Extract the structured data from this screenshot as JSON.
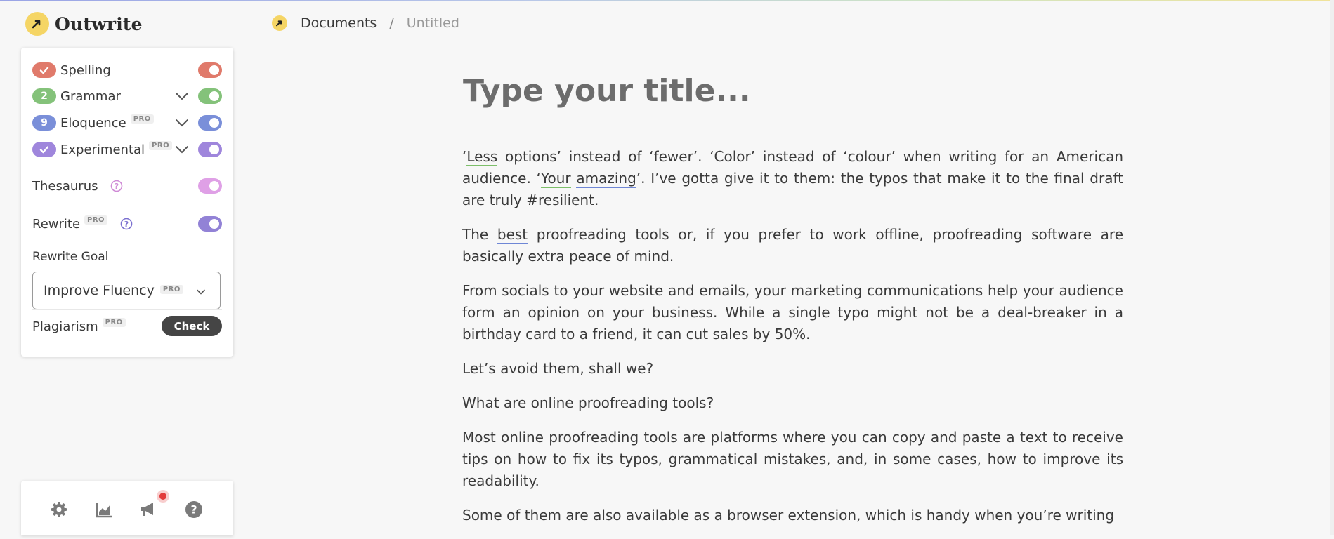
{
  "app": {
    "name": "Outwrite"
  },
  "breadcrumb": {
    "root": "Documents",
    "separator": "/",
    "current": "Untitled"
  },
  "colors": {
    "spelling": "#e07a6b",
    "grammar": "#84c27a",
    "eloquence": "#7a8fd9",
    "experimental": "#9f86dc",
    "thesaurus": "#dfa0e6",
    "rewrite": "#9282d6"
  },
  "settings": {
    "spelling": {
      "label": "Spelling",
      "badge_icon": "check-icon",
      "enabled": true
    },
    "grammar": {
      "label": "Grammar",
      "count": "2",
      "enabled": true
    },
    "eloquence": {
      "label": "Eloquence",
      "count": "9",
      "pro": "PRO",
      "enabled": true
    },
    "experimental": {
      "label": "Experimental",
      "badge_icon": "check-icon",
      "pro": "PRO",
      "enabled": true
    },
    "thesaurus": {
      "label": "Thesaurus",
      "enabled": true
    },
    "rewrite": {
      "label": "Rewrite",
      "pro": "PRO",
      "enabled": true
    },
    "rewrite_goal": {
      "label": "Rewrite Goal",
      "value": "Improve Fluency",
      "pro": "PRO"
    },
    "plagiarism": {
      "label": "Plagiarism",
      "pro": "PRO",
      "button": "Check"
    }
  },
  "bottom_bar": {
    "icons": [
      "gear-icon",
      "stats-chart-icon",
      "megaphone-icon",
      "help-circle-icon"
    ]
  },
  "editor": {
    "title_placeholder": "Type your title...",
    "p1": {
      "q1": "‘",
      "w1": "Less",
      "t1": " options’ instead of ‘fewer’. ‘Color’ instead of ‘colour’ when writing for an American audience. ‘",
      "w2": "Your",
      "t2": " ",
      "w3": "amazing",
      "t3": "’. I’ve gotta give it to them: the typos that make it to the final draft are truly #resilient."
    },
    "p2": {
      "t1": "The ",
      "w1": "best",
      "t2": " proofreading tools or, if you prefer to work offline, proofreading software are basically extra peace of mind."
    },
    "p3": "From socials to your website and emails, your marketing communications help your audience form an opinion on your business. While a single typo might not be a deal-breaker in a birthday card to a friend, it can cut sales by 50%.",
    "p4": "Let’s avoid them, shall we?",
    "p5": "What are online proofreading tools?",
    "p6": "Most online proofreading tools are platforms where you can copy and paste a text to receive tips on how to fix its typos, grammatical mistakes, and, in some cases, how to improve its readability.",
    "p7": "Some of them are also available as a browser extension, which is handy when you’re writing"
  }
}
